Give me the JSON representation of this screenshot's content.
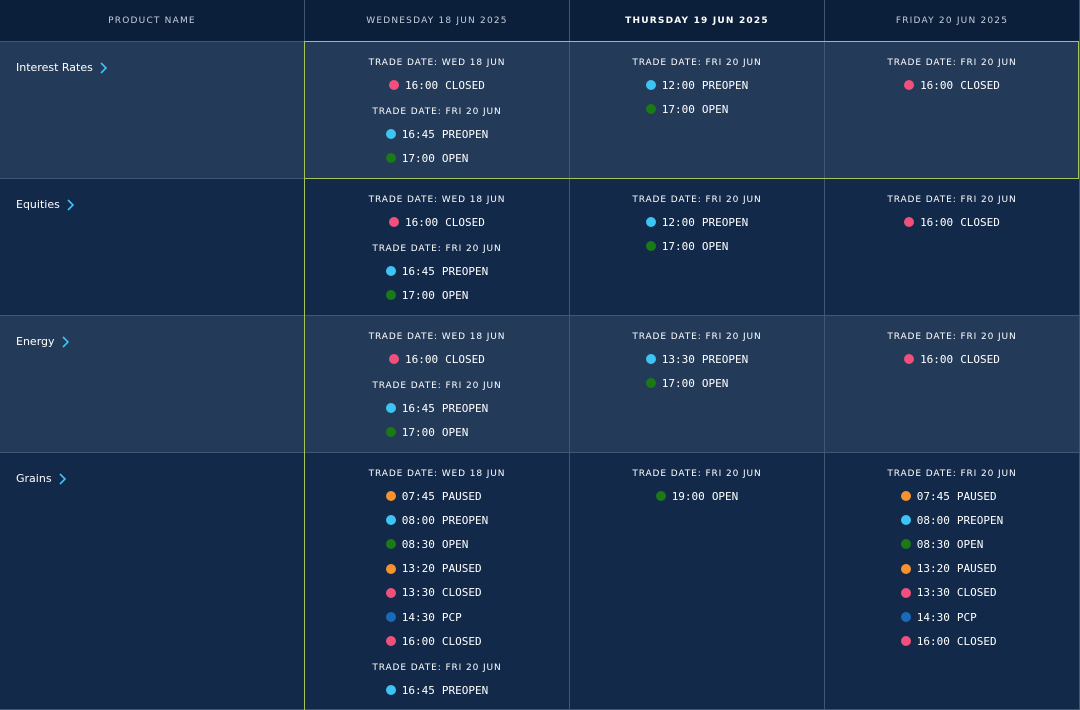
{
  "colors": {
    "CLOSED": "#f0507a",
    "PREOPEN": "#3cc4f4",
    "OPEN": "#1a7a17",
    "PAUSED": "#f7922e",
    "PCP": "#1a6ab8",
    "chevron": "#3cc4f4"
  },
  "header": {
    "product_col": "PRODUCT NAME",
    "days": [
      "WEDNESDAY 18 JUN 2025",
      "THURSDAY 19 JUN 2025",
      "FRIDAY 20 JUN 2025"
    ]
  },
  "rows": [
    {
      "name": "Interest Rates",
      "cells": [
        [
          {
            "trade_date": "TRADE DATE: WED 18 JUN",
            "entries": [
              {
                "time": "16:00",
                "status": "CLOSED"
              }
            ]
          },
          {
            "trade_date": "TRADE DATE: FRI 20 JUN",
            "entries": [
              {
                "time": "16:45",
                "status": "PREOPEN"
              },
              {
                "time": "17:00",
                "status": "OPEN"
              }
            ]
          }
        ],
        [
          {
            "trade_date": "TRADE DATE: FRI 20 JUN",
            "entries": [
              {
                "time": "12:00",
                "status": "PREOPEN"
              },
              {
                "time": "17:00",
                "status": "OPEN"
              }
            ]
          }
        ],
        [
          {
            "trade_date": "TRADE DATE: FRI 20 JUN",
            "entries": [
              {
                "time": "16:00",
                "status": "CLOSED"
              }
            ]
          }
        ]
      ]
    },
    {
      "name": "Equities",
      "cells": [
        [
          {
            "trade_date": "TRADE DATE: WED 18 JUN",
            "entries": [
              {
                "time": "16:00",
                "status": "CLOSED"
              }
            ]
          },
          {
            "trade_date": "TRADE DATE: FRI 20 JUN",
            "entries": [
              {
                "time": "16:45",
                "status": "PREOPEN"
              },
              {
                "time": "17:00",
                "status": "OPEN"
              }
            ]
          }
        ],
        [
          {
            "trade_date": "TRADE DATE: FRI 20 JUN",
            "entries": [
              {
                "time": "12:00",
                "status": "PREOPEN"
              },
              {
                "time": "17:00",
                "status": "OPEN"
              }
            ]
          }
        ],
        [
          {
            "trade_date": "TRADE DATE: FRI 20 JUN",
            "entries": [
              {
                "time": "16:00",
                "status": "CLOSED"
              }
            ]
          }
        ]
      ]
    },
    {
      "name": "Energy",
      "cells": [
        [
          {
            "trade_date": "TRADE DATE: WED 18 JUN",
            "entries": [
              {
                "time": "16:00",
                "status": "CLOSED"
              }
            ]
          },
          {
            "trade_date": "TRADE DATE: FRI 20 JUN",
            "entries": [
              {
                "time": "16:45",
                "status": "PREOPEN"
              },
              {
                "time": "17:00",
                "status": "OPEN"
              }
            ]
          }
        ],
        [
          {
            "trade_date": "TRADE DATE: FRI 20 JUN",
            "entries": [
              {
                "time": "13:30",
                "status": "PREOPEN"
              },
              {
                "time": "17:00",
                "status": "OPEN"
              }
            ]
          }
        ],
        [
          {
            "trade_date": "TRADE DATE: FRI 20 JUN",
            "entries": [
              {
                "time": "16:00",
                "status": "CLOSED"
              }
            ]
          }
        ]
      ]
    },
    {
      "name": "Grains",
      "cells": [
        [
          {
            "trade_date": "TRADE DATE: WED 18 JUN",
            "entries": [
              {
                "time": "07:45",
                "status": "PAUSED"
              },
              {
                "time": "08:00",
                "status": "PREOPEN"
              },
              {
                "time": "08:30",
                "status": "OPEN"
              },
              {
                "time": "13:20",
                "status": "PAUSED"
              },
              {
                "time": "13:30",
                "status": "CLOSED"
              },
              {
                "time": "14:30",
                "status": "PCP"
              },
              {
                "time": "16:00",
                "status": "CLOSED"
              }
            ]
          },
          {
            "trade_date": "TRADE DATE: FRI 20 JUN",
            "entries": [
              {
                "time": "16:45",
                "status": "PREOPEN"
              }
            ]
          }
        ],
        [
          {
            "trade_date": "TRADE DATE: FRI 20 JUN",
            "entries": [
              {
                "time": "19:00",
                "status": "OPEN"
              }
            ]
          }
        ],
        [
          {
            "trade_date": "TRADE DATE: FRI 20 JUN",
            "entries": [
              {
                "time": "07:45",
                "status": "PAUSED"
              },
              {
                "time": "08:00",
                "status": "PREOPEN"
              },
              {
                "time": "08:30",
                "status": "OPEN"
              },
              {
                "time": "13:20",
                "status": "PAUSED"
              },
              {
                "time": "13:30",
                "status": "CLOSED"
              },
              {
                "time": "14:30",
                "status": "PCP"
              },
              {
                "time": "16:00",
                "status": "CLOSED"
              }
            ]
          }
        ]
      ]
    }
  ]
}
